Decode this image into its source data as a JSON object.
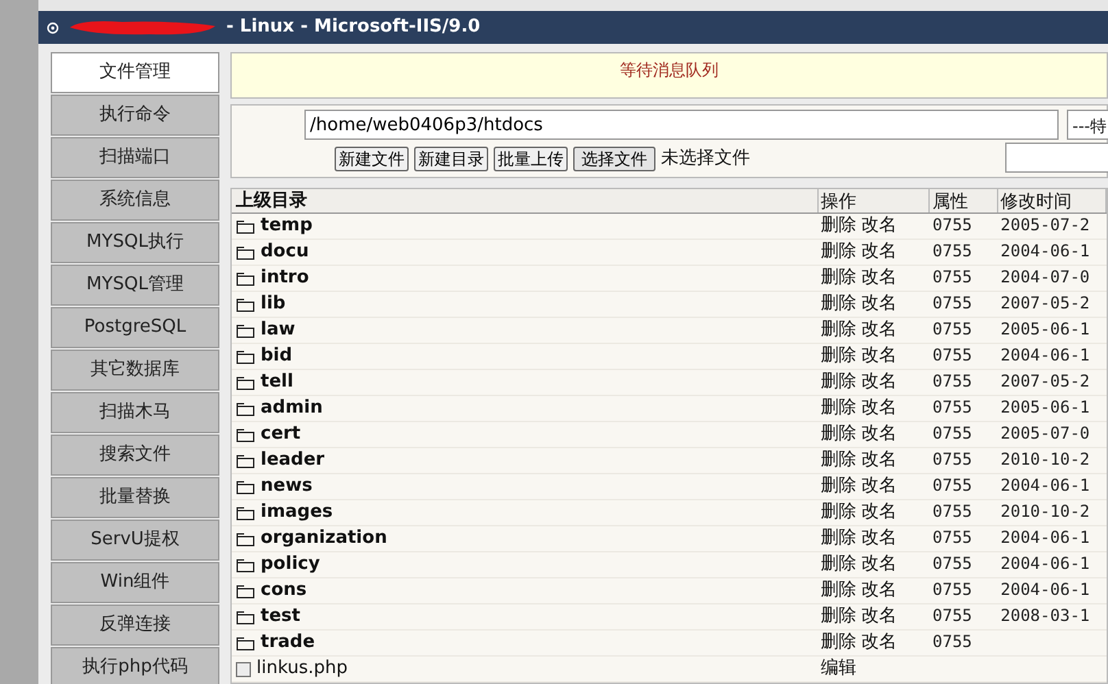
{
  "header": {
    "title": "- Linux - Microsoft-IIS/9.0"
  },
  "sidebar": {
    "items": [
      {
        "label": "文件管理",
        "selected": true
      },
      {
        "label": "执行命令",
        "selected": false
      },
      {
        "label": "扫描端口",
        "selected": false
      },
      {
        "label": "系统信息",
        "selected": false
      },
      {
        "label": "MYSQL执行",
        "selected": false
      },
      {
        "label": "MYSQL管理",
        "selected": false
      },
      {
        "label": "PostgreSQL",
        "selected": false
      },
      {
        "label": "其它数据库",
        "selected": false
      },
      {
        "label": "扫描木马",
        "selected": false
      },
      {
        "label": "搜索文件",
        "selected": false
      },
      {
        "label": "批量替换",
        "selected": false
      },
      {
        "label": "ServU提权",
        "selected": false
      },
      {
        "label": "Win组件",
        "selected": false
      },
      {
        "label": "反弹连接",
        "selected": false
      },
      {
        "label": "执行php代码",
        "selected": false
      }
    ]
  },
  "notice": "等待消息队列",
  "path_field": {
    "value": "/home/web0406p3/htdocs"
  },
  "select": {
    "value": "---特"
  },
  "buttons": [
    "新建文件",
    "新建目录",
    "批量上传",
    "选择文件"
  ],
  "file_status": "未选择文件",
  "table": {
    "columns": [
      "上级目录",
      "操作",
      "属性",
      "修改时间"
    ],
    "rows": [
      {
        "kind": "folder",
        "name": "temp",
        "actions": [
          "删除",
          "改名"
        ],
        "perm": "0755",
        "mtime": "2005-07-2"
      },
      {
        "kind": "folder",
        "name": "docu",
        "actions": [
          "删除",
          "改名"
        ],
        "perm": "0755",
        "mtime": "2004-06-1"
      },
      {
        "kind": "folder",
        "name": "intro",
        "actions": [
          "删除",
          "改名"
        ],
        "perm": "0755",
        "mtime": "2004-07-0"
      },
      {
        "kind": "folder",
        "name": "lib",
        "actions": [
          "删除",
          "改名"
        ],
        "perm": "0755",
        "mtime": "2007-05-2"
      },
      {
        "kind": "folder",
        "name": "law",
        "actions": [
          "删除",
          "改名"
        ],
        "perm": "0755",
        "mtime": "2005-06-1"
      },
      {
        "kind": "folder",
        "name": "bid",
        "actions": [
          "删除",
          "改名"
        ],
        "perm": "0755",
        "mtime": "2004-06-1"
      },
      {
        "kind": "folder",
        "name": "tell",
        "actions": [
          "删除",
          "改名"
        ],
        "perm": "0755",
        "mtime": "2007-05-2"
      },
      {
        "kind": "folder",
        "name": "admin",
        "actions": [
          "删除",
          "改名"
        ],
        "perm": "0755",
        "mtime": "2005-06-1"
      },
      {
        "kind": "folder",
        "name": "cert",
        "actions": [
          "删除",
          "改名"
        ],
        "perm": "0755",
        "mtime": "2005-07-0"
      },
      {
        "kind": "folder",
        "name": "leader",
        "actions": [
          "删除",
          "改名"
        ],
        "perm": "0755",
        "mtime": "2010-10-2"
      },
      {
        "kind": "folder",
        "name": "news",
        "actions": [
          "删除",
          "改名"
        ],
        "perm": "0755",
        "mtime": "2004-06-1"
      },
      {
        "kind": "folder",
        "name": "images",
        "actions": [
          "删除",
          "改名"
        ],
        "perm": "0755",
        "mtime": "2010-10-2"
      },
      {
        "kind": "folder",
        "name": "organization",
        "actions": [
          "删除",
          "改名"
        ],
        "perm": "0755",
        "mtime": "2004-06-1"
      },
      {
        "kind": "folder",
        "name": "policy",
        "actions": [
          "删除",
          "改名"
        ],
        "perm": "0755",
        "mtime": "2004-06-1"
      },
      {
        "kind": "folder",
        "name": "cons",
        "actions": [
          "删除",
          "改名"
        ],
        "perm": "0755",
        "mtime": "2004-06-1"
      },
      {
        "kind": "folder",
        "name": "test",
        "actions": [
          "删除",
          "改名"
        ],
        "perm": "0755",
        "mtime": "2008-03-1"
      },
      {
        "kind": "folder",
        "name": "trade",
        "actions": [
          "删除",
          "改名"
        ],
        "perm": "0755"
      },
      {
        "kind": "file",
        "name": "linkus.php",
        "actions": [
          "编辑"
        ]
      }
    ]
  }
}
